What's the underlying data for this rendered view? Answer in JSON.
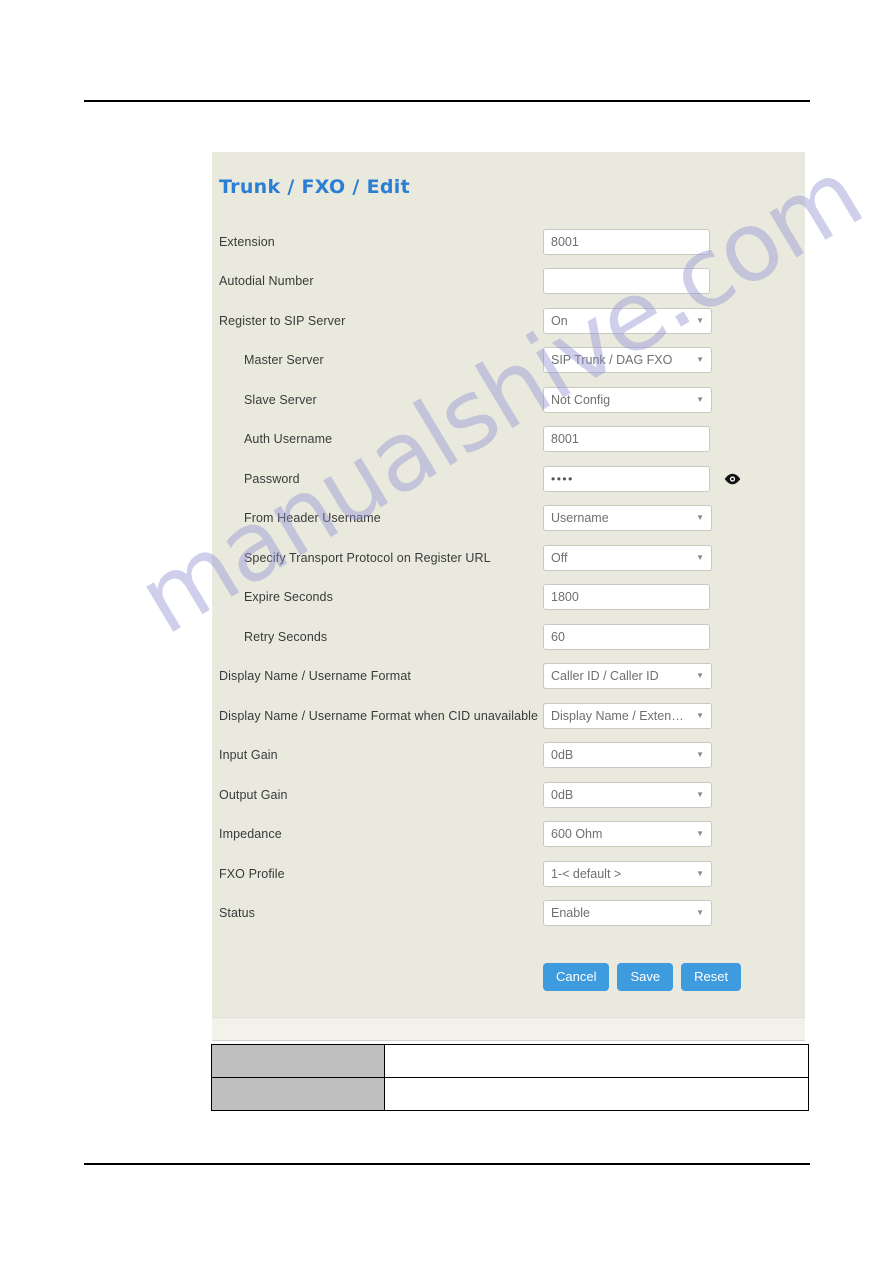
{
  "document": {
    "watermark": "manualshive.com",
    "watermark_color": "#8f8fd4",
    "accent_color": "#2a7fd4",
    "panel_background": "#e9e9de",
    "button_color": "#3e9bdd"
  },
  "panel": {
    "title": "Trunk / FXO / Edit",
    "fields": [
      {
        "label": "Extension",
        "type": "text",
        "value": "8001",
        "placeholder": "",
        "indent": false,
        "name": "extension"
      },
      {
        "label": "Autodial Number",
        "type": "text",
        "value": "",
        "placeholder": "",
        "indent": false,
        "name": "autodial-number"
      },
      {
        "label": "Register to SIP Server",
        "type": "select",
        "value": "On",
        "indent": false,
        "name": "register-to-sip-server"
      },
      {
        "label": "Master Server",
        "type": "select",
        "value": "SIP Trunk / DAG FXO",
        "indent": true,
        "name": "master-server"
      },
      {
        "label": "Slave Server",
        "type": "select",
        "value": "Not Config",
        "indent": true,
        "name": "slave-server"
      },
      {
        "label": "Auth Username",
        "type": "text",
        "value": "8001",
        "placeholder": "",
        "indent": true,
        "name": "auth-username"
      },
      {
        "label": "Password",
        "type": "password",
        "value": "••••",
        "indent": true,
        "name": "password",
        "trailing_icon": "eye-icon"
      },
      {
        "label": "From Header Username",
        "type": "select",
        "value": "Username",
        "indent": true,
        "name": "from-header-username"
      },
      {
        "label": "Specify Transport Protocol on Register URL",
        "type": "select",
        "value": "Off",
        "indent": true,
        "name": "specify-transport-protocol-on-register-url"
      },
      {
        "label": "Expire Seconds",
        "type": "text",
        "value": "1800",
        "placeholder": "",
        "indent": true,
        "name": "expire-seconds"
      },
      {
        "label": "Retry Seconds",
        "type": "text",
        "value": "60",
        "placeholder": "",
        "indent": true,
        "name": "retry-seconds"
      },
      {
        "label": "Display Name / Username Format",
        "type": "select",
        "value": "Caller ID / Caller ID",
        "indent": false,
        "name": "display-name-username-format"
      },
      {
        "label": "Display Name / Username Format when CID unavailable",
        "type": "select",
        "value": "Display Name / Extension",
        "indent": false,
        "name": "display-name-username-format-when-cid-unavailable"
      },
      {
        "label": "Input Gain",
        "type": "select",
        "value": "0dB",
        "indent": false,
        "name": "input-gain"
      },
      {
        "label": "Output Gain",
        "type": "select",
        "value": "0dB",
        "indent": false,
        "name": "output-gain"
      },
      {
        "label": "Impedance",
        "type": "select",
        "value": "600 Ohm",
        "indent": false,
        "name": "impedance"
      },
      {
        "label": "FXO Profile",
        "type": "select",
        "value": "1-< default >",
        "indent": false,
        "name": "fxo-profile"
      },
      {
        "label": "Status",
        "type": "select",
        "value": "Enable",
        "indent": false,
        "name": "status"
      }
    ],
    "buttons": [
      {
        "label": "Cancel",
        "name": "cancel-button"
      },
      {
        "label": "Save",
        "name": "save-button"
      },
      {
        "label": "Reset",
        "name": "reset-button"
      }
    ]
  },
  "bottom_table": {
    "rows": [
      {
        "key": "",
        "value": ""
      },
      {
        "key": "",
        "value": ""
      }
    ]
  }
}
